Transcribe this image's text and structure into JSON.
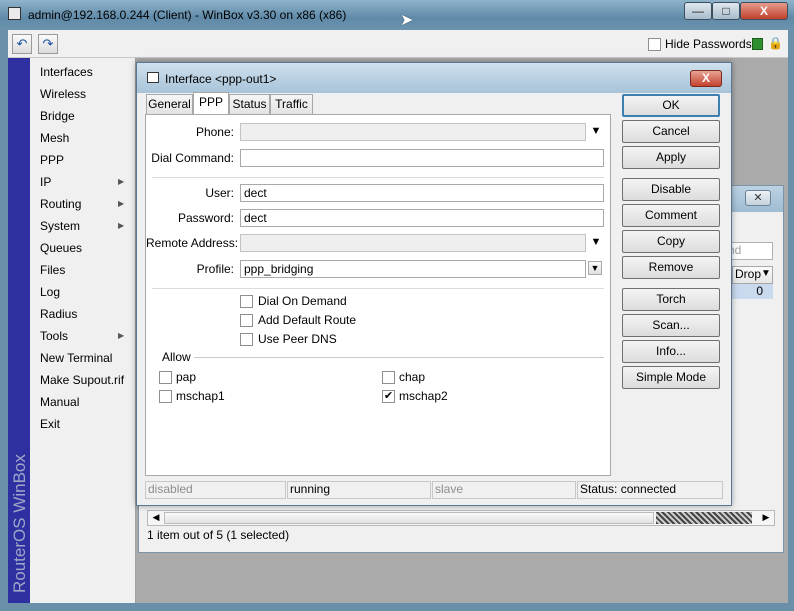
{
  "window": {
    "title": "admin@192.168.0.244 (Client) - WinBox v3.30 on x86 (x86)",
    "hide_passwords_label": "Hide Passwords",
    "hide_passwords_checked": false
  },
  "buttons": {
    "minimize": "—",
    "maximize": "□",
    "close": "X"
  },
  "toolbar": {
    "undo_icon": "undo-icon",
    "redo_icon": "redo-icon"
  },
  "sidebar": {
    "brand": "RouterOS WinBox",
    "items": [
      {
        "label": "Interfaces",
        "submenu": false
      },
      {
        "label": "Wireless",
        "submenu": false
      },
      {
        "label": "Bridge",
        "submenu": false
      },
      {
        "label": "Mesh",
        "submenu": false
      },
      {
        "label": "PPP",
        "submenu": false
      },
      {
        "label": "IP",
        "submenu": true
      },
      {
        "label": "Routing",
        "submenu": true
      },
      {
        "label": "System",
        "submenu": true
      },
      {
        "label": "Queues",
        "submenu": false
      },
      {
        "label": "Files",
        "submenu": false
      },
      {
        "label": "Log",
        "submenu": false
      },
      {
        "label": "Radius",
        "submenu": false
      },
      {
        "label": "Tools",
        "submenu": true
      },
      {
        "label": "New Terminal",
        "submenu": false
      },
      {
        "label": "Make Supout.rif",
        "submenu": false
      },
      {
        "label": "Manual",
        "submenu": false
      },
      {
        "label": "Exit",
        "submenu": false
      }
    ]
  },
  "list_window": {
    "find_placeholder": "nd",
    "column_header": "Drop",
    "selected_value": "0",
    "status": "1 item out of 5 (1 selected)"
  },
  "dialog": {
    "title": "Interface <ppp-out1>",
    "tabs": [
      "General",
      "PPP",
      "Status",
      "Traffic"
    ],
    "active_tab": "PPP",
    "fields": {
      "phone": {
        "label": "Phone:",
        "value": ""
      },
      "dial_command": {
        "label": "Dial Command:",
        "value": ""
      },
      "user": {
        "label": "User:",
        "value": "dect"
      },
      "password": {
        "label": "Password:",
        "value": "dect"
      },
      "remote_address": {
        "label": "Remote Address:",
        "value": ""
      },
      "profile": {
        "label": "Profile:",
        "value": "ppp_bridging"
      }
    },
    "options": [
      {
        "label": "Dial On Demand",
        "checked": false
      },
      {
        "label": "Add Default Route",
        "checked": false
      },
      {
        "label": "Use Peer DNS",
        "checked": false
      }
    ],
    "allow": {
      "label": "Allow",
      "items": [
        {
          "label": "pap",
          "checked": false
        },
        {
          "label": "chap",
          "checked": false
        },
        {
          "label": "mschap1",
          "checked": false
        },
        {
          "label": "mschap2",
          "checked": true
        }
      ]
    },
    "buttons": [
      "OK",
      "Cancel",
      "Apply",
      "Disable",
      "Comment",
      "Copy",
      "Remove",
      "Torch",
      "Scan...",
      "Info...",
      "Simple Mode"
    ],
    "status_bar": [
      "disabled",
      "running",
      "slave",
      "Status: connected"
    ]
  }
}
